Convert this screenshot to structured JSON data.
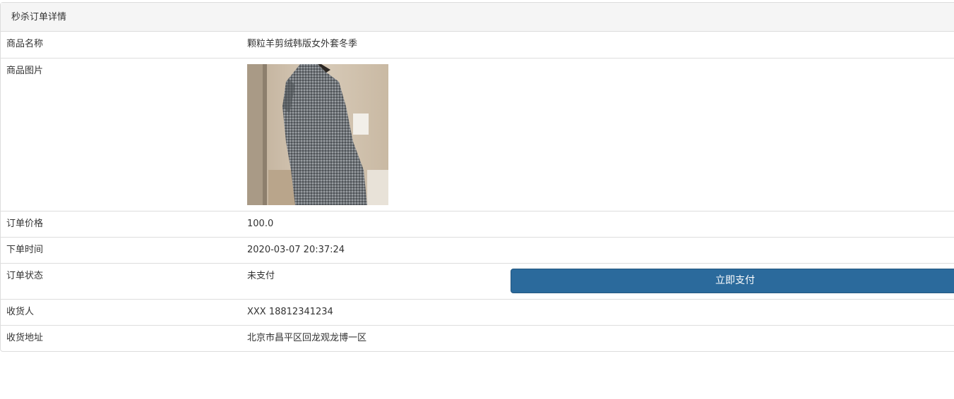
{
  "panel": {
    "title": "秒杀订单详情"
  },
  "rows": {
    "product_name": {
      "label": "商品名称",
      "value": "颗粒羊剪绒韩版女外套冬季"
    },
    "product_image": {
      "label": "商品图片"
    },
    "order_price": {
      "label": "订单价格",
      "value": "100.0"
    },
    "order_time": {
      "label": "下单时间",
      "value": "2020-03-07 20:37:24"
    },
    "order_status": {
      "label": "订单状态",
      "value": "未支付",
      "pay_button_label": "立即支付"
    },
    "receiver": {
      "label": "收货人",
      "value": "XXX 18812341234"
    },
    "address": {
      "label": "收货地址",
      "value": "北京市昌平区回龙观龙博一区"
    }
  },
  "colors": {
    "pay_button": "#2b6a9c",
    "heading_bg": "#f5f5f5",
    "border": "#dddddd"
  }
}
